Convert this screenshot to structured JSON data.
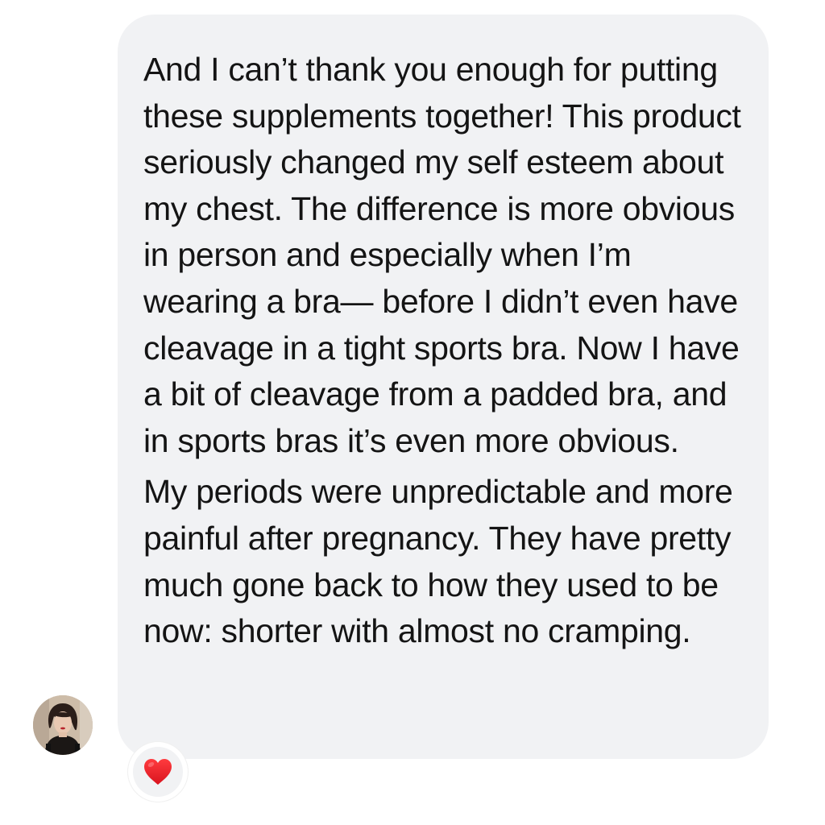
{
  "message": {
    "paragraphs": [
      "And I can’t thank you enough for putting these supplements together! This product seriously changed my self esteem about my chest. The difference is more obvious in person and especially when I’m wearing a bra— before I didn’t even have cleavage in a tight sports bra. Now I have a bit of cleavage from a padded bra, and in sports bras it’s even more obvious.",
      "My periods were unpredictable and more painful after pregnancy. They have pretty much gone back to how they used to be now: shorter with almost no cramping."
    ],
    "bubble_color": "#f1f2f4",
    "text_color": "#141414"
  },
  "sender": {
    "avatar_icon": "avatar-photo"
  },
  "reaction": {
    "icon": "heart-icon",
    "color": "#e8232d"
  }
}
